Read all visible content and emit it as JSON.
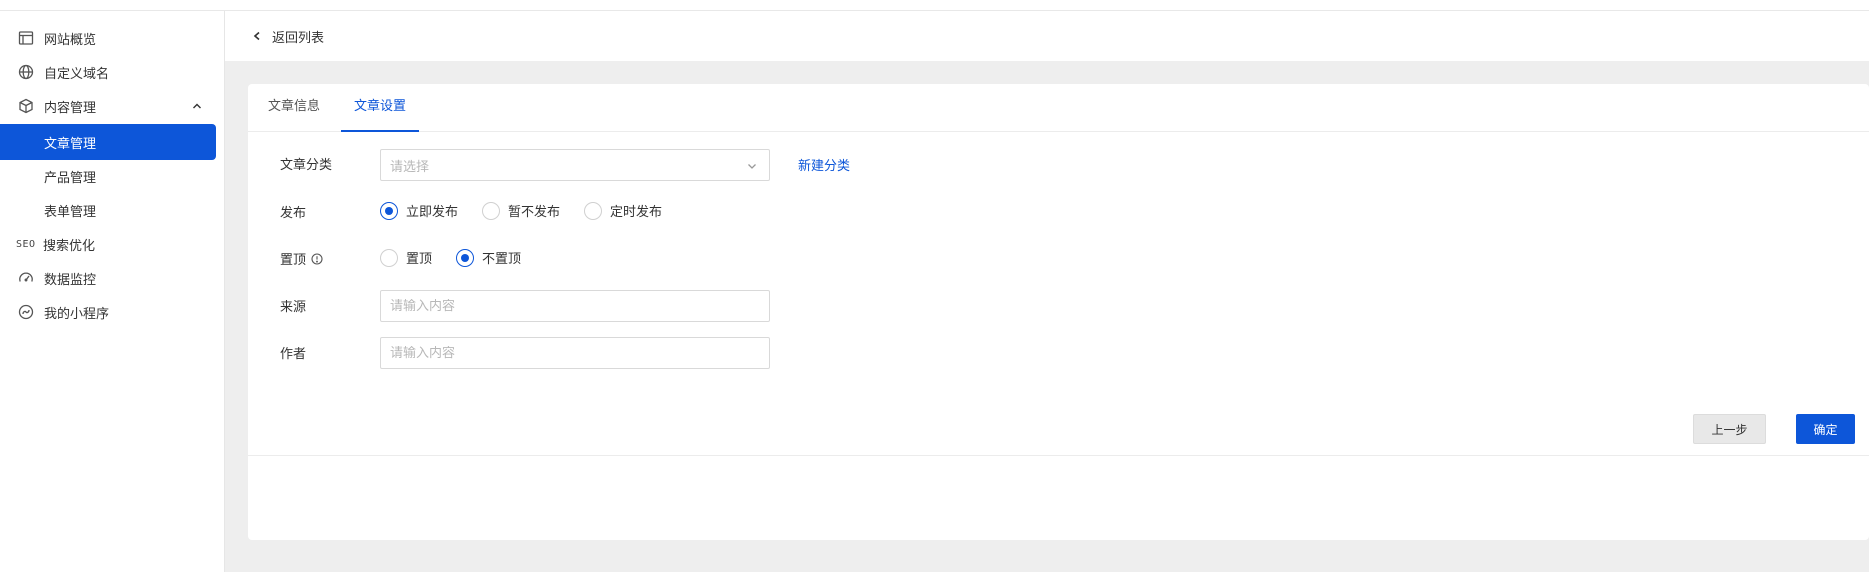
{
  "sidebar": {
    "items": [
      {
        "label": "网站概览",
        "icon": "browser-window-icon"
      },
      {
        "label": "自定义域名",
        "icon": "globe-icon"
      },
      {
        "label": "内容管理",
        "icon": "cube-icon",
        "expanded": true
      },
      {
        "label": "SEO",
        "icon": "seo-text-icon",
        "text": "搜索优化"
      },
      {
        "label": "数据监控",
        "icon": "gauge-icon"
      },
      {
        "label": "我的小程序",
        "icon": "mini-program-icon"
      }
    ],
    "sub_items": [
      {
        "label": "文章管理",
        "active": true
      },
      {
        "label": "产品管理",
        "active": false
      },
      {
        "label": "表单管理",
        "active": false
      }
    ]
  },
  "header": {
    "back_label": "返回列表"
  },
  "tabs": [
    {
      "label": "文章信息",
      "active": false
    },
    {
      "label": "文章设置",
      "active": true
    }
  ],
  "form": {
    "category": {
      "label": "文章分类",
      "placeholder": "请选择",
      "new_link": "新建分类"
    },
    "publish": {
      "label": "发布",
      "options": [
        "立即发布",
        "暂不发布",
        "定时发布"
      ],
      "selected": "立即发布"
    },
    "pin": {
      "label": "置顶",
      "options": [
        "置顶",
        "不置顶"
      ],
      "selected": "不置顶"
    },
    "source": {
      "label": "来源",
      "placeholder": "请输入内容"
    },
    "author": {
      "label": "作者",
      "placeholder": "请输入内容"
    }
  },
  "actions": {
    "prev_label": "上一步",
    "confirm_label": "确定"
  },
  "colors": {
    "primary": "#0d56d9",
    "background": "#eeeeee"
  }
}
